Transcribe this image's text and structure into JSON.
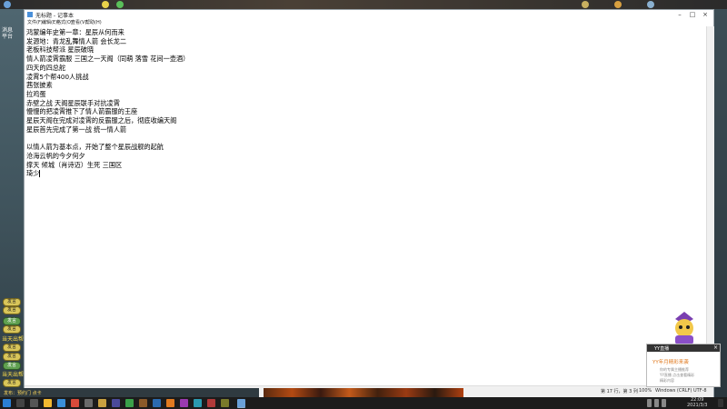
{
  "game": {
    "left_label": "消息\n平台",
    "pills": [
      "发言",
      "发言",
      "发言",
      "发言",
      "发言",
      "发言",
      "发言",
      "发言"
    ],
    "side_texts": [
      "当天出帮",
      "当天出帮"
    ],
    "bottom_text": "发布：预约门 点卡"
  },
  "notepad": {
    "title": "无标题 - 记事本",
    "menu": [
      "文件(F)",
      "编辑(E)",
      "格式(O)",
      "查看(V)",
      "帮助(H)"
    ],
    "lines": [
      "鸿蒙编年史第一章：星辰从何而来",
      "发源地：青龙乱舞情人箭 会长龙二",
      "老板科技帮派 星辰破晓",
      "情人箭凌霄霸服 三国之一天阁（同萌 落雪 花间一壶酒）",
      "四天的四总舵",
      "凌霄5个帮400人挑战",
      "茜张披素",
      "拉鸡蛋",
      "赤壁之战 天阁星辰联手对抗凌霄",
      "慢慢的把凌霄推下了情人箭霸服的王座",
      "星辰天阁在完成对凌霄的反霸服之后，彻底收编天阁",
      "星辰首先完成了第一战 统一情人箭",
      "",
      "以情人箭为基本点，开始了整个星辰战舰的起航",
      "沧海云帆的今夕何夕",
      "撑天 倾城（肖诗迈）生死 三国区",
      "琦少"
    ],
    "status": [
      "第 17 行，第 3 列",
      "100%",
      "Windows (CRLF)",
      "UTF-8"
    ]
  },
  "overlay": {
    "title": "YY直播",
    "headline": "YY年月精彩来袭",
    "sub1": "你的专属主播推荐",
    "sub2": "YY直播 点击查看精彩",
    "sub3": "精彩内容"
  },
  "taskbar": {
    "clock_time": "22:09",
    "clock_date": "2021/3/3"
  },
  "colors": {
    "game_pill": "#d9c65a",
    "overlay_headline": "#e07a20",
    "taskbar": "#1c1c1c"
  }
}
